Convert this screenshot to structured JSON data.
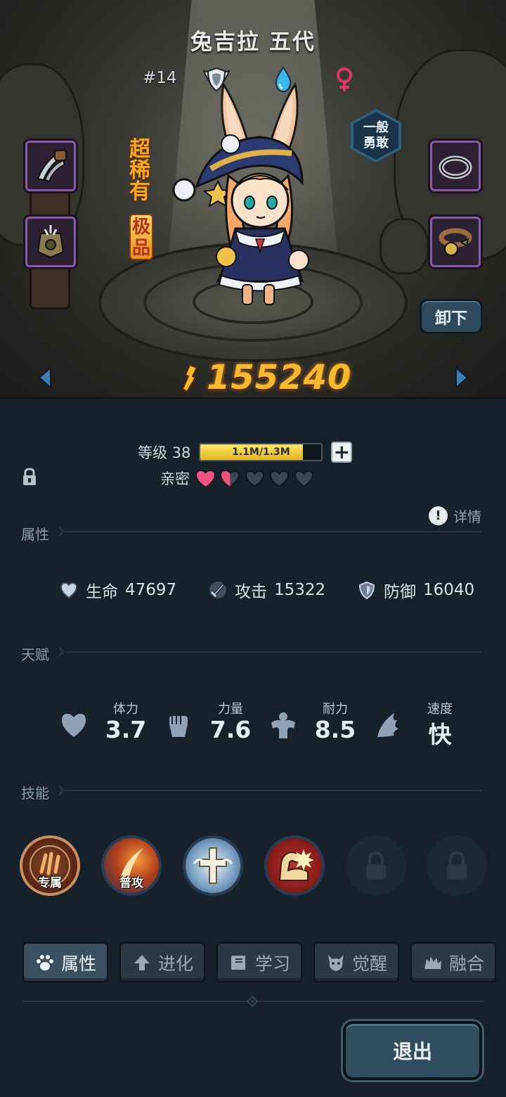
{
  "character": {
    "name": "兔吉拉 五代",
    "number": "#14",
    "rarity": "超稀有",
    "quality": "极品",
    "personality": [
      "一般",
      "勇敢"
    ],
    "unequip_label": "卸下",
    "combat_power": "155240"
  },
  "growth": {
    "level_label": "等级 38",
    "exp_text": "1.1M/1.3M",
    "exp_fraction": 0.846,
    "intimacy_label": "亲密",
    "intimacy_hearts": [
      1,
      0.5,
      0,
      0,
      0
    ]
  },
  "sections": {
    "attributes": "属性",
    "talent": "天赋",
    "skills": "技能",
    "details": "详情"
  },
  "stats": [
    {
      "icon": "heart-shield-icon",
      "label": "生命",
      "value": "47697"
    },
    {
      "icon": "sword-icon",
      "label": "攻击",
      "value": "15322"
    },
    {
      "icon": "shield-icon",
      "label": "防御",
      "value": "16040"
    }
  ],
  "talents": [
    {
      "icon": "heart-icon",
      "label": "体力",
      "value": "3.7"
    },
    {
      "icon": "fist-icon",
      "label": "力量",
      "value": "7.6"
    },
    {
      "icon": "muscle-icon",
      "label": "耐力",
      "value": "8.5"
    },
    {
      "icon": "wing-icon",
      "label": "速度",
      "value": "快"
    }
  ],
  "skills": [
    {
      "icon": "claw-emblem-icon",
      "label": "专属",
      "locked": false
    },
    {
      "icon": "slash-icon",
      "label": "普攻",
      "locked": false
    },
    {
      "icon": "winged-cross-icon",
      "label": "",
      "locked": false
    },
    {
      "icon": "flexed-arm-icon",
      "label": "",
      "locked": false
    },
    {
      "icon": "lock-icon",
      "label": "",
      "locked": true
    },
    {
      "icon": "lock-icon",
      "label": "",
      "locked": true
    }
  ],
  "tabs": [
    {
      "icon": "paw-icon",
      "label": "属性",
      "active": true
    },
    {
      "icon": "arrow-up-icon",
      "label": "进化",
      "active": false
    },
    {
      "icon": "book-icon",
      "label": "学习",
      "active": false
    },
    {
      "icon": "demon-icon",
      "label": "觉醒",
      "active": false
    },
    {
      "icon": "merge-icon",
      "label": "融合",
      "active": false
    }
  ],
  "exit_label": "退出",
  "colors": {
    "background": "#16212b",
    "power": "#f7b92f",
    "rarity": "#f5a623",
    "heart_full": "#f0537e",
    "heart_empty": "#3c4650",
    "active_tab": "#38505f"
  }
}
